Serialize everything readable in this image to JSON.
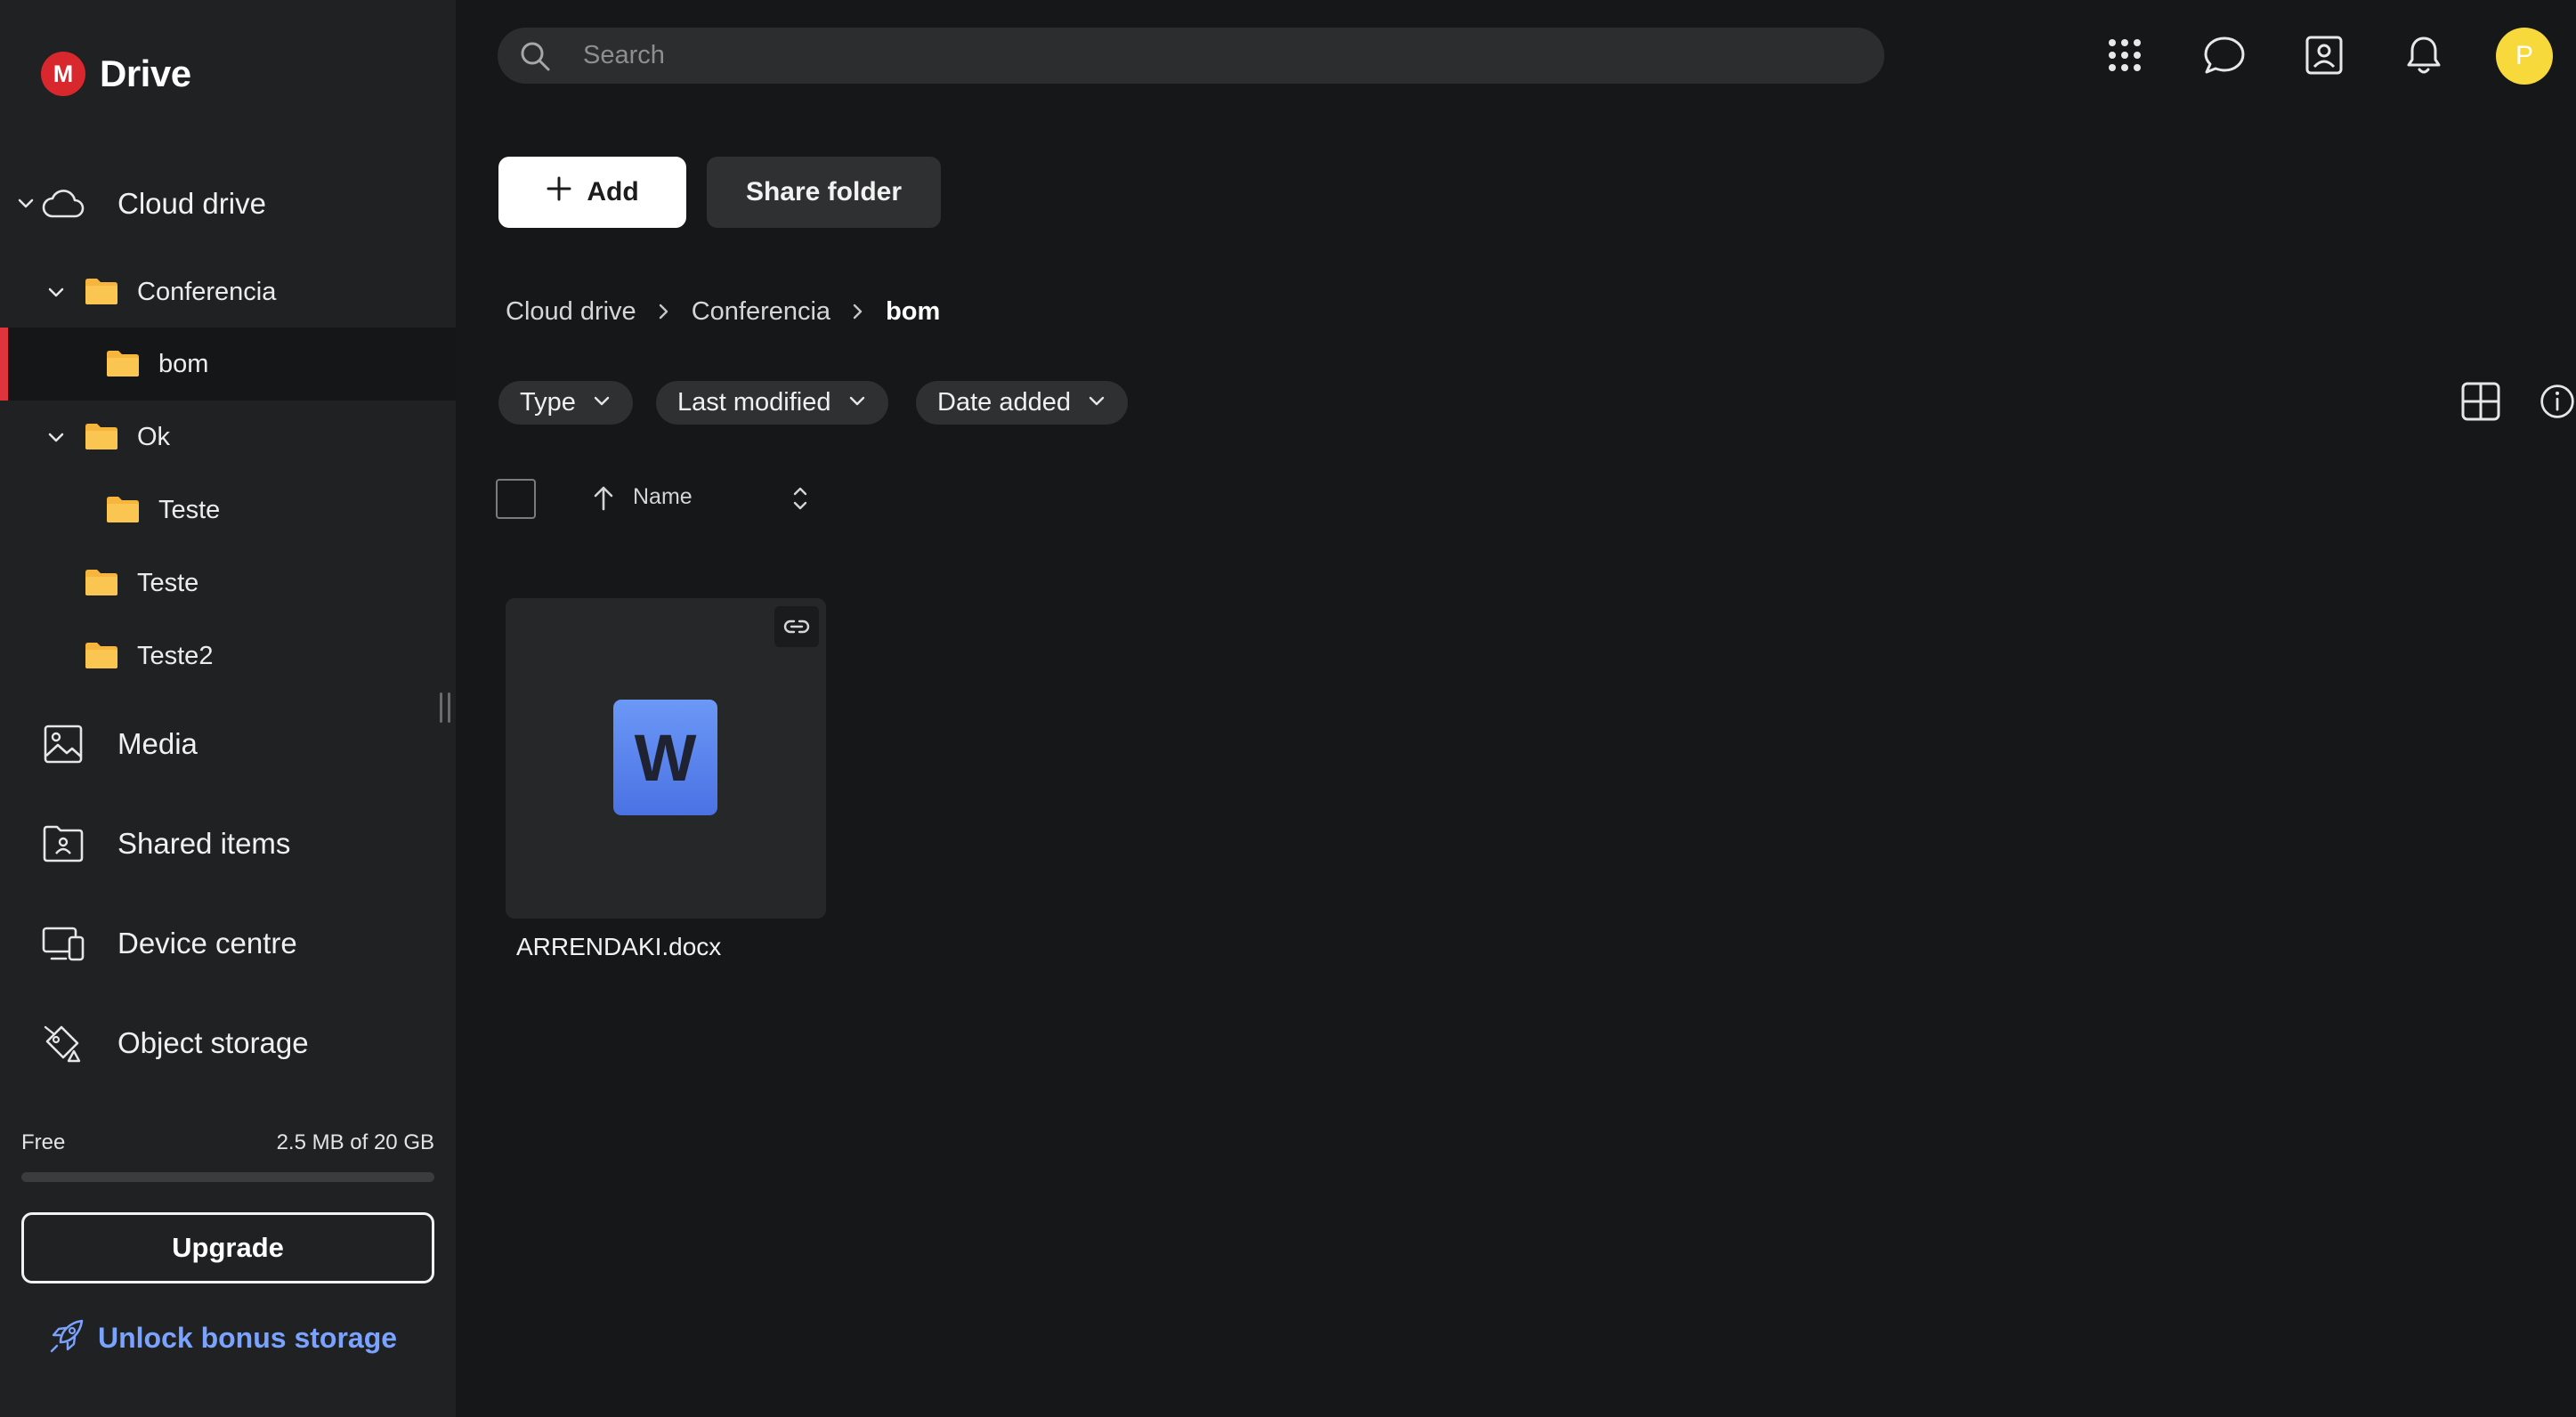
{
  "app": {
    "brand_letter": "M",
    "brand_name": "Drive",
    "accent_color": "#d9272e"
  },
  "sidebar": {
    "nav": [
      {
        "label": "Cloud drive",
        "icon": "cloud-icon",
        "expanded": true
      },
      {
        "label": "Media",
        "icon": "image-icon"
      },
      {
        "label": "Shared items",
        "icon": "shared-folder-icon"
      },
      {
        "label": "Device centre",
        "icon": "devices-icon"
      },
      {
        "label": "Object storage",
        "icon": "object-storage-icon"
      }
    ],
    "tree": [
      {
        "label": "Conferencia",
        "level": 1,
        "expanded": true
      },
      {
        "label": "bom",
        "level": 2,
        "selected": true
      },
      {
        "label": "Ok",
        "level": 1,
        "expanded": true
      },
      {
        "label": "Teste",
        "level": 2
      },
      {
        "label": "Teste",
        "level": 1
      },
      {
        "label": "Teste2",
        "level": 1
      }
    ],
    "storage": {
      "plan": "Free",
      "usage": "2.5 MB of 20 GB",
      "used_fraction": 0.000125
    },
    "upgrade_label": "Upgrade",
    "bonus_label": "Unlock bonus storage"
  },
  "topbar": {
    "search_placeholder": "Search",
    "icons": [
      "apps-grid-icon",
      "chat-icon",
      "contacts-icon",
      "bell-icon"
    ],
    "avatar_initial": "P",
    "avatar_color": "#f7d93c"
  },
  "actions": {
    "add_label": "Add",
    "share_label": "Share folder"
  },
  "breadcrumb": [
    "Cloud drive",
    "Conferencia",
    "bom"
  ],
  "filters": [
    "Type",
    "Last modified",
    "Date added"
  ],
  "list_header": {
    "name_label": "Name"
  },
  "files": [
    {
      "name": "ARRENDAKI.docx",
      "type_letter": "W",
      "linked": true
    }
  ]
}
